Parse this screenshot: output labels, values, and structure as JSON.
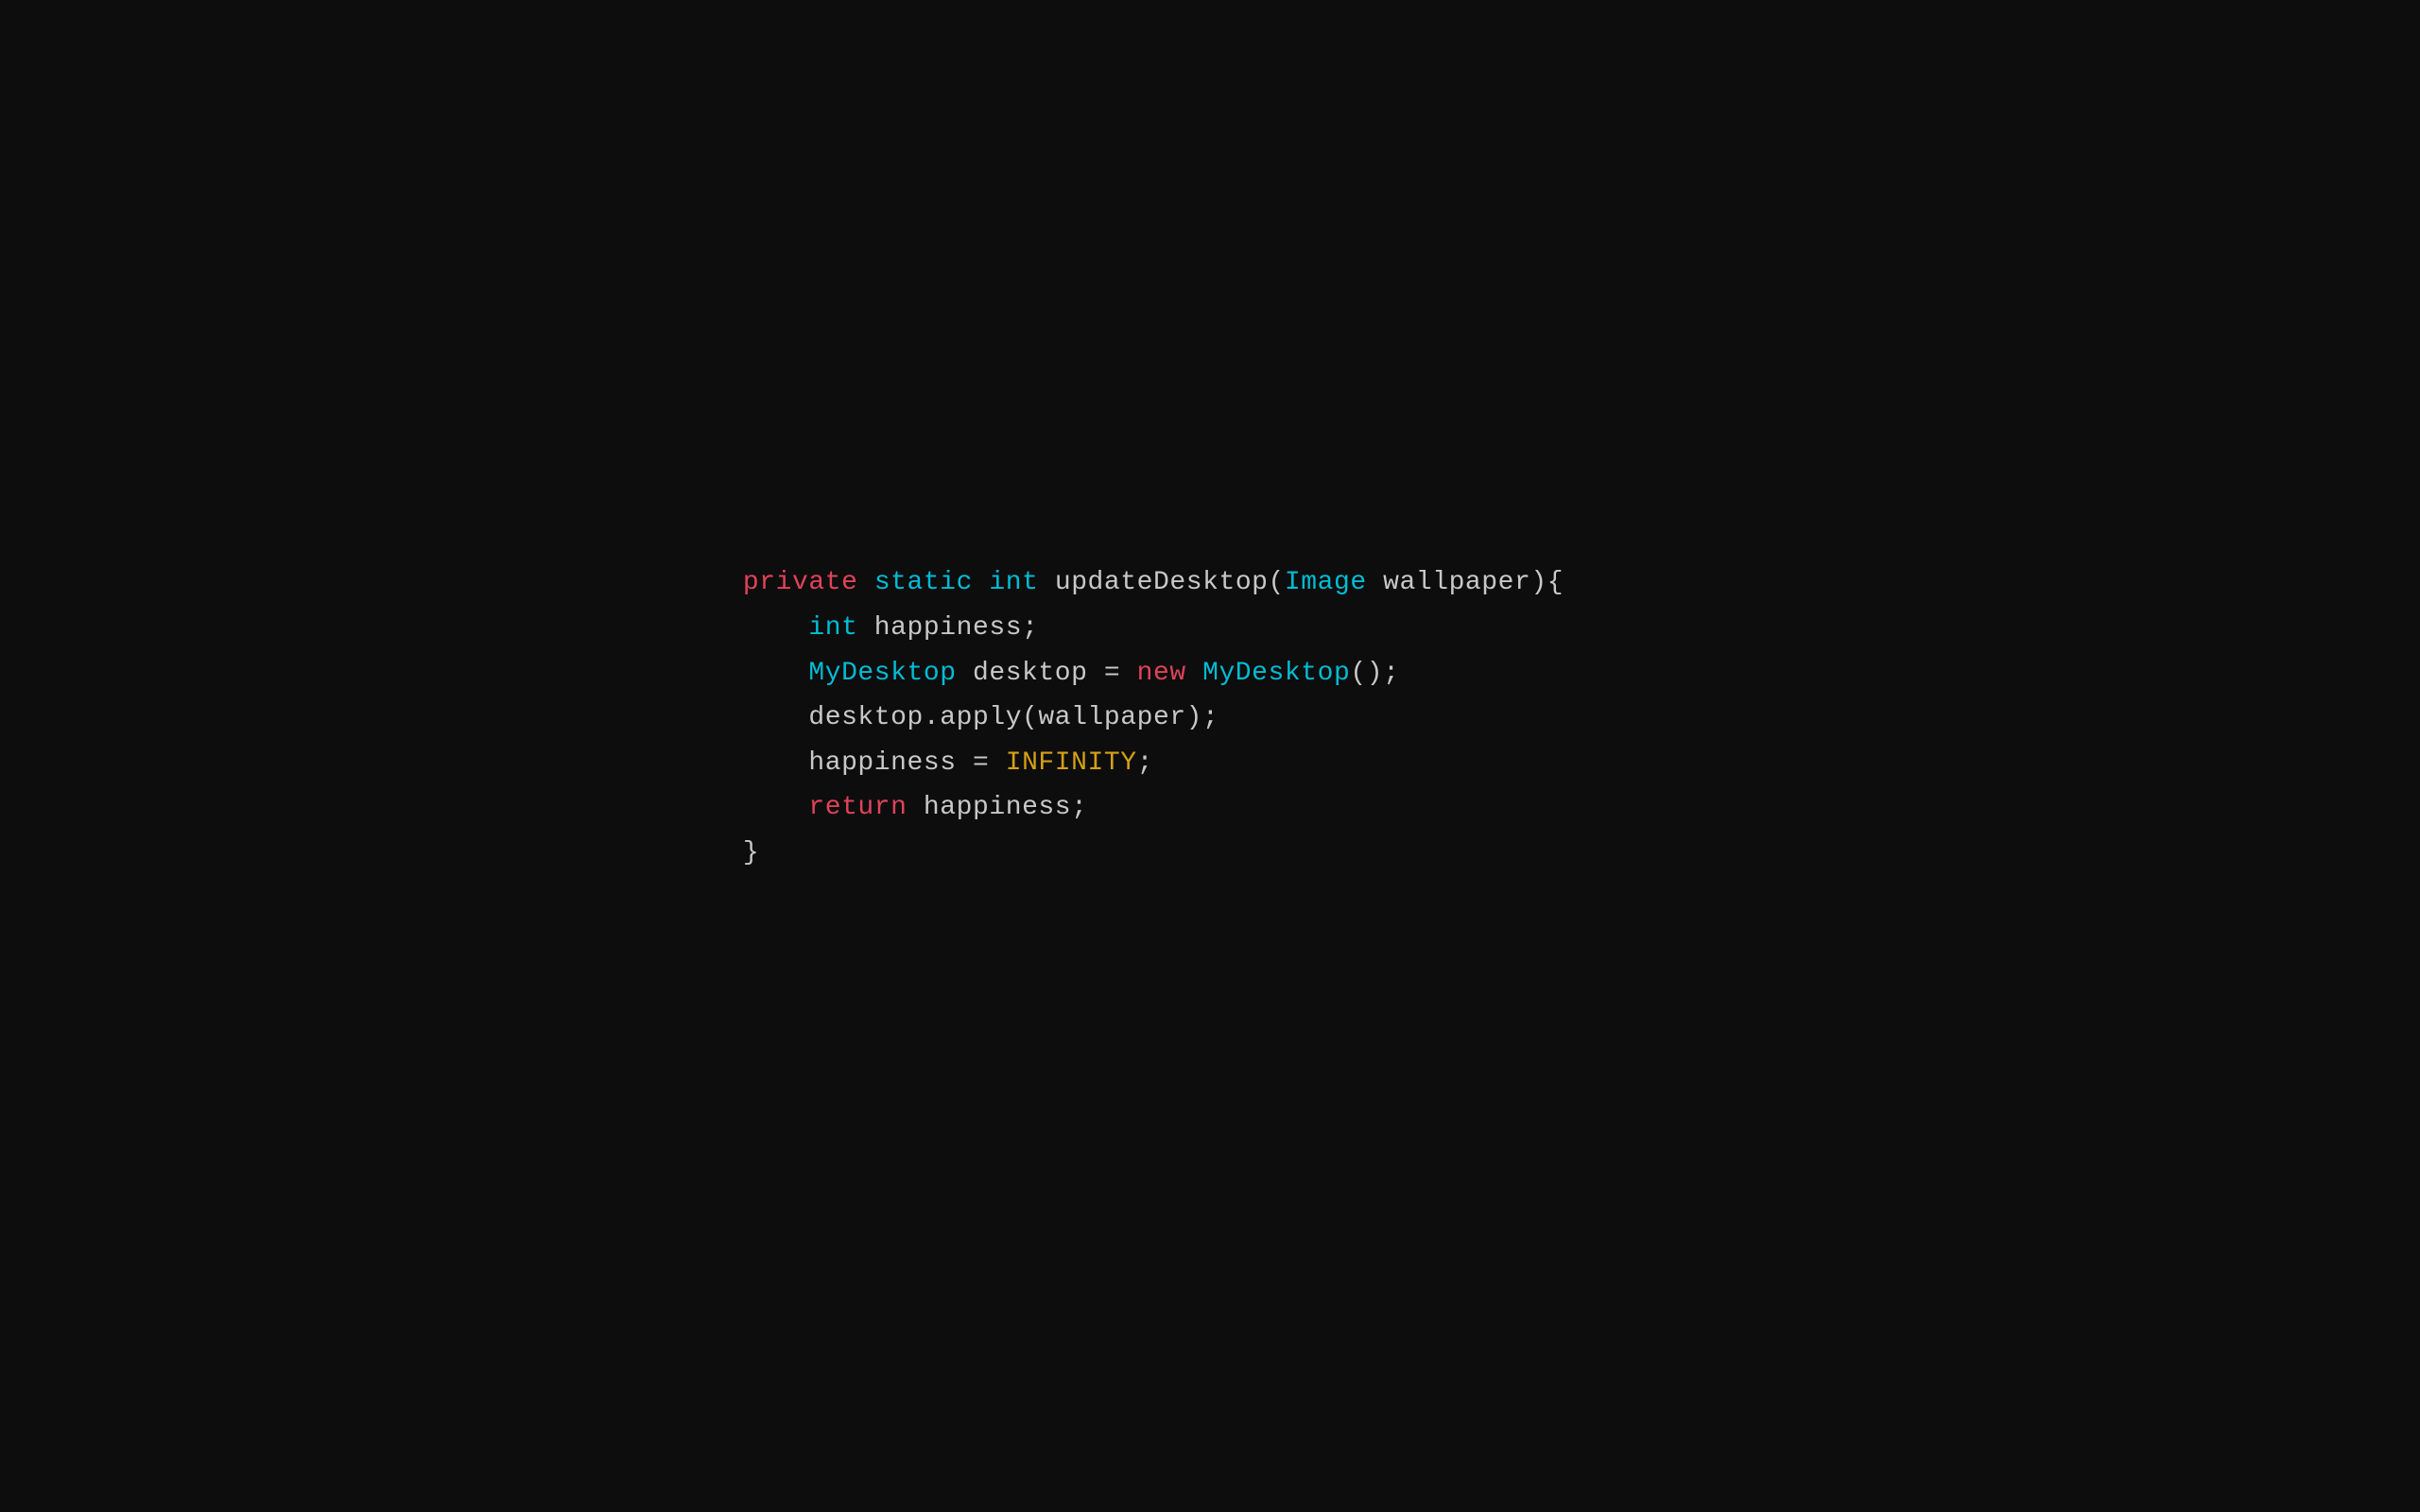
{
  "background": "#0d0d0d",
  "code": {
    "lines": [
      {
        "id": "line1",
        "parts": [
          {
            "text": "private",
            "class": "keyword-private"
          },
          {
            "text": " ",
            "class": "text-plain"
          },
          {
            "text": "static",
            "class": "keyword-static"
          },
          {
            "text": " ",
            "class": "text-plain"
          },
          {
            "text": "int",
            "class": "keyword-int"
          },
          {
            "text": " updateDesktop(",
            "class": "text-plain"
          },
          {
            "text": "Image",
            "class": "type-image"
          },
          {
            "text": " wallpaper){",
            "class": "text-plain"
          }
        ]
      },
      {
        "id": "line2",
        "indent": "    ",
        "parts": [
          {
            "text": "    ",
            "class": "text-plain"
          },
          {
            "text": "int",
            "class": "keyword-int"
          },
          {
            "text": " happiness;",
            "class": "text-plain"
          }
        ]
      },
      {
        "id": "line3",
        "parts": [
          {
            "text": "    ",
            "class": "text-plain"
          },
          {
            "text": "MyDesktop",
            "class": "type-mydesktop"
          },
          {
            "text": " desktop = ",
            "class": "text-plain"
          },
          {
            "text": "new",
            "class": "keyword-new"
          },
          {
            "text": " ",
            "class": "text-plain"
          },
          {
            "text": "MyDesktop",
            "class": "type-mydesktop"
          },
          {
            "text": "();",
            "class": "text-plain"
          }
        ]
      },
      {
        "id": "line4",
        "parts": [
          {
            "text": "    desktop.apply(wallpaper);",
            "class": "text-plain"
          }
        ]
      },
      {
        "id": "line5",
        "parts": [
          {
            "text": "    happiness = ",
            "class": "text-plain"
          },
          {
            "text": "INFINITY",
            "class": "keyword-infinity"
          },
          {
            "text": ";",
            "class": "text-plain"
          }
        ]
      },
      {
        "id": "line6",
        "parts": [
          {
            "text": "    ",
            "class": "text-plain"
          },
          {
            "text": "return",
            "class": "keyword-return"
          },
          {
            "text": " happiness;",
            "class": "text-plain"
          }
        ]
      },
      {
        "id": "line7",
        "parts": [
          {
            "text": "}",
            "class": "text-plain"
          }
        ]
      }
    ]
  }
}
